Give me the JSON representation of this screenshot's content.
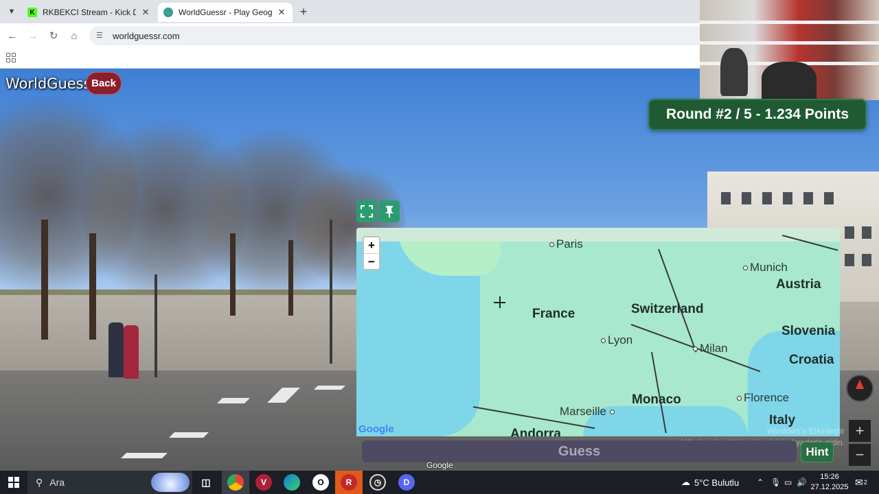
{
  "browser": {
    "tabs": [
      {
        "title": "RKBEKCI Stream - Kick Dashboa",
        "favicon": "kick-icon",
        "active": false
      },
      {
        "title": "WorldGuessr - Play Geoguessr F",
        "favicon": "globe-icon",
        "active": true
      }
    ],
    "new_tab_label": "+",
    "address": "worldguessr.com"
  },
  "game": {
    "logo": "WorldGuessr",
    "back_label": "Back",
    "round_banner": "Round #2 / 5 - 1.234 Points",
    "guess_label": "Guess",
    "hint_label": "Hint",
    "zoom_in": "+",
    "zoom_out": "−"
  },
  "map": {
    "attribution": "Google",
    "labels": [
      {
        "text": "Paris",
        "kind": "city",
        "dot": true
      },
      {
        "text": "France",
        "kind": "country",
        "dot": false
      },
      {
        "text": "Switzerland",
        "kind": "country",
        "dot": false
      },
      {
        "text": "Munich",
        "kind": "city",
        "dot": true
      },
      {
        "text": "Austria",
        "kind": "country",
        "dot": false
      },
      {
        "text": "Lyon",
        "kind": "city",
        "dot": true
      },
      {
        "text": "Milan",
        "kind": "city",
        "dot": true
      },
      {
        "text": "Slovenia",
        "kind": "country",
        "dot": false
      },
      {
        "text": "Croatia",
        "kind": "country",
        "dot": false
      },
      {
        "text": "Monaco",
        "kind": "country",
        "dot": false
      },
      {
        "text": "Marseille",
        "kind": "city",
        "dot": true
      },
      {
        "text": "Florence",
        "kind": "city",
        "dot": true
      },
      {
        "text": "Italy",
        "kind": "country",
        "dot": false
      },
      {
        "text": "Andorra",
        "kind": "country",
        "dot": false
      }
    ]
  },
  "streetview": {
    "attribution": "Google",
    "watermark_line1": "Windows'u Etkinleştir",
    "watermark_line2": "Windows'u etkinleştirmek için Ayarlar'a gidin."
  },
  "taskbar": {
    "search_placeholder": "Ara",
    "weather": "5°C Bulutlu",
    "time": "15:26",
    "date": "27.12.2025",
    "notification_count": "2"
  },
  "colors": {
    "round_banner_bg": "#1f5a32",
    "back_button_bg": "#8b1e2a",
    "map_tools_bg": "#2a9d6e",
    "guess_bar_bg": "#4d4a63",
    "hint_bg": "#2a6e44"
  }
}
